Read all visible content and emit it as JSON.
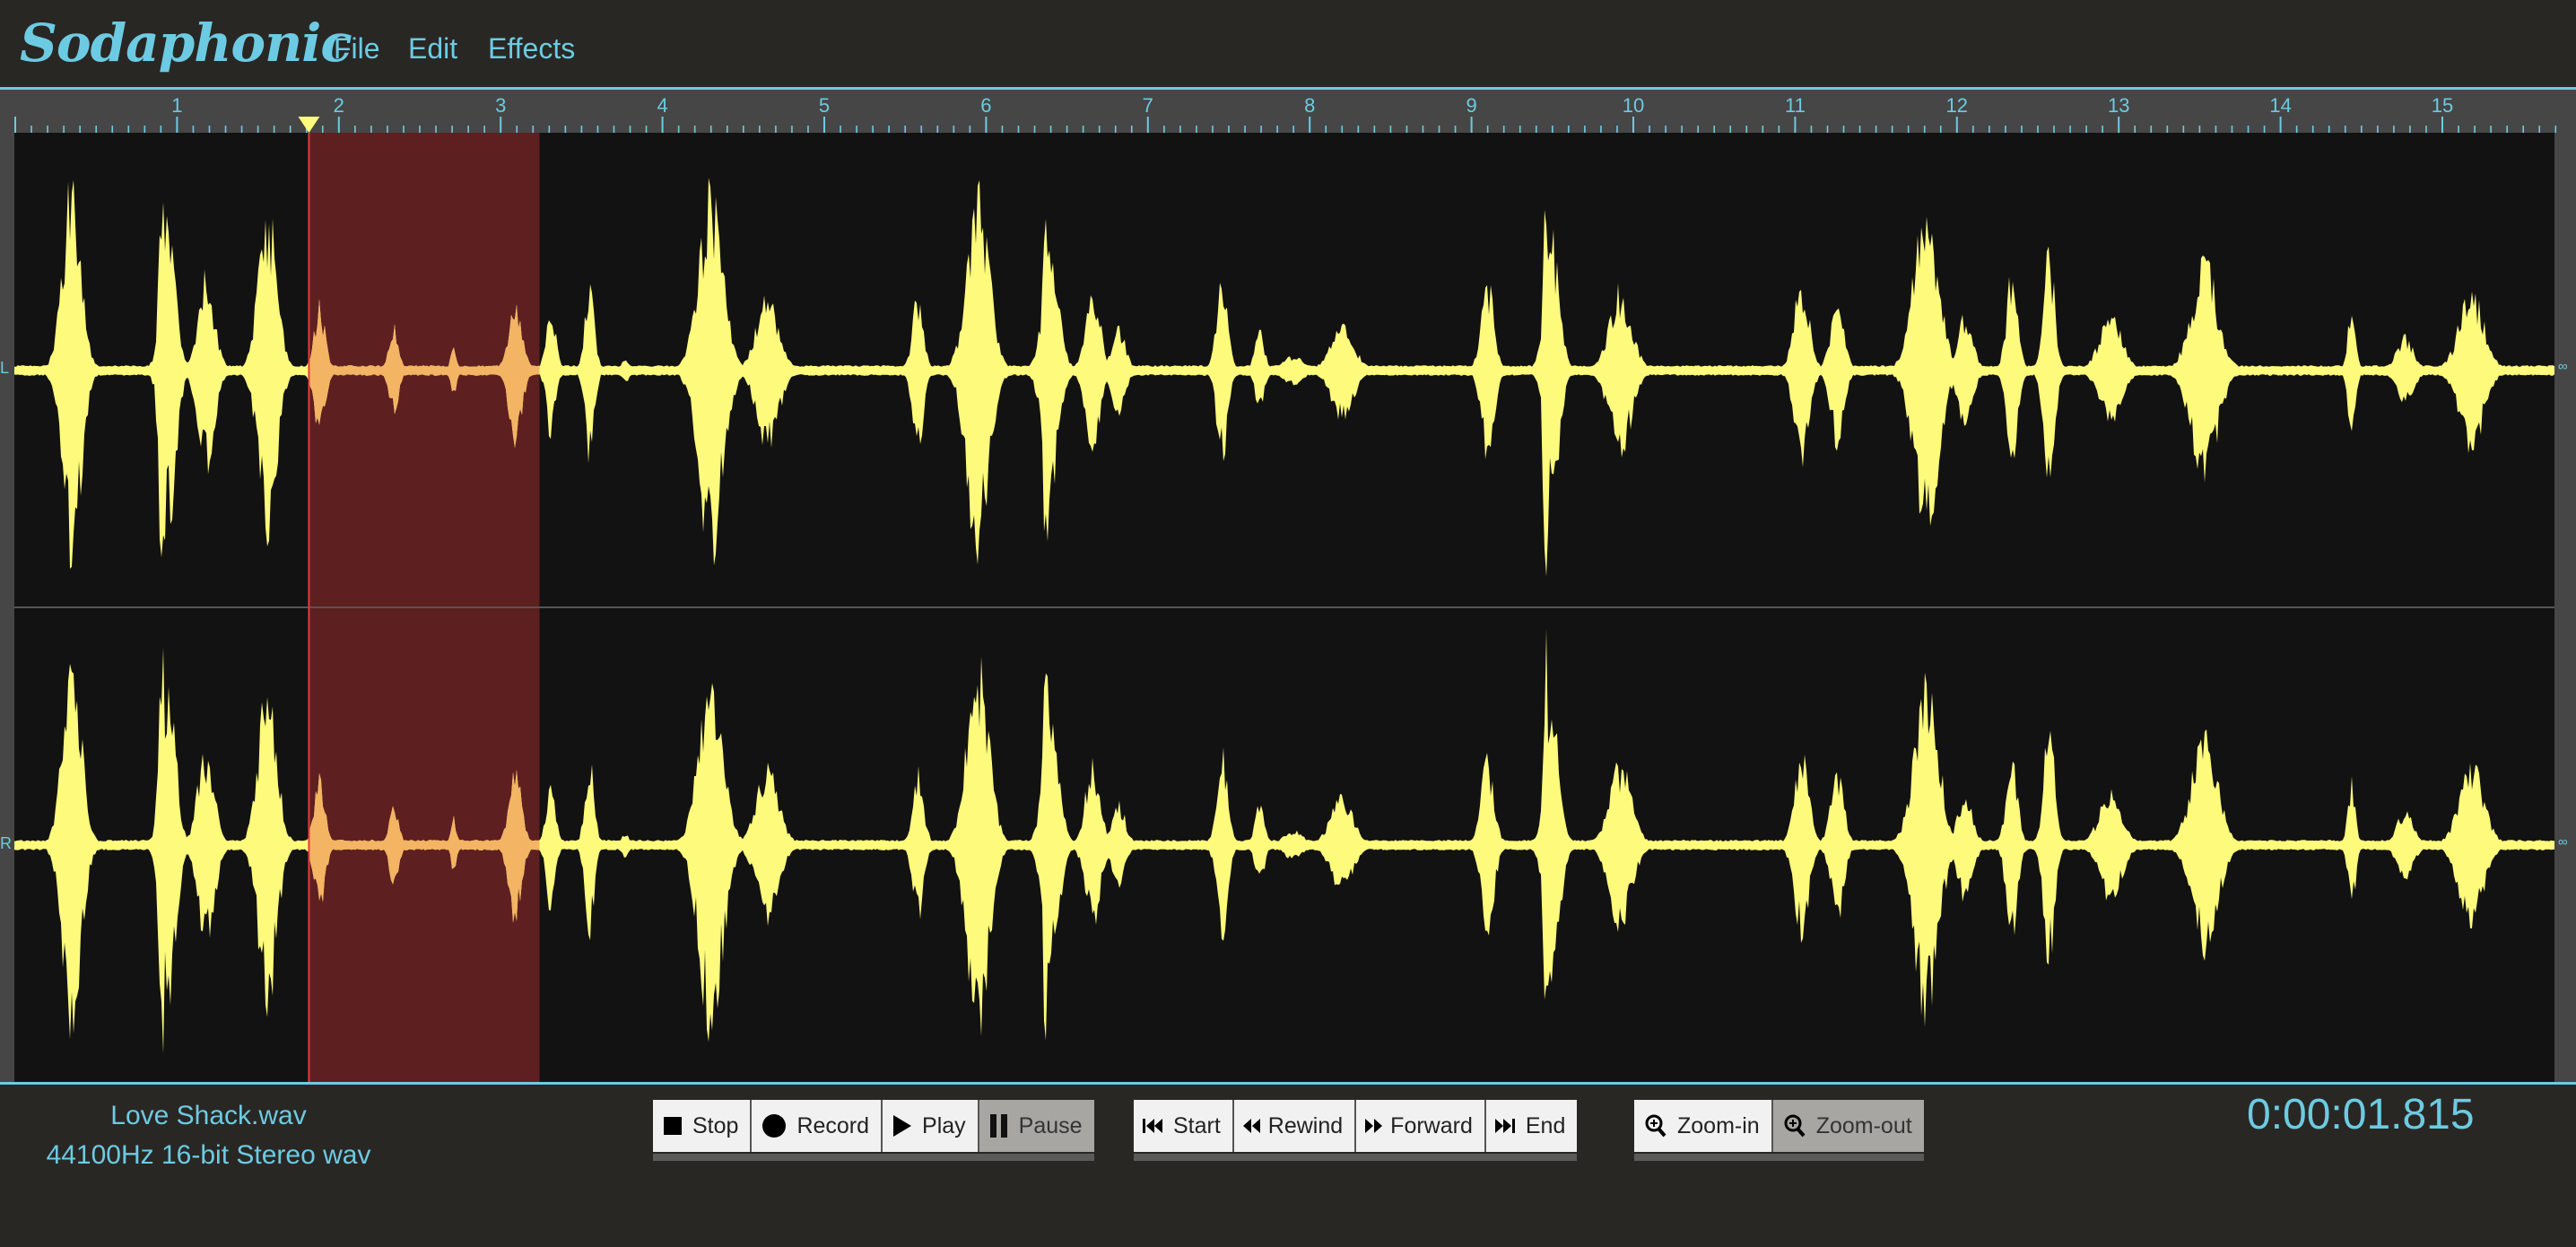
{
  "app": {
    "title": "Sodaphonic"
  },
  "menu": [
    {
      "label": "File"
    },
    {
      "label": "Edit"
    },
    {
      "label": "Effects"
    }
  ],
  "ruler": {
    "labels": [
      "1",
      "2",
      "3",
      "4",
      "5",
      "6",
      "7",
      "8",
      "9",
      "10",
      "11",
      "12",
      "13",
      "14",
      "15"
    ],
    "start_s": 0,
    "end_s": 15.7,
    "minor_step_s": 0.1
  },
  "channels": [
    {
      "label": "L",
      "db_label": "∞"
    },
    {
      "label": "R",
      "db_label": "∞"
    }
  ],
  "selection": {
    "start_s": 1.815,
    "end_s": 3.24
  },
  "playhead_s": 1.815,
  "colors": {
    "accent": "#6ccbe2",
    "waveform": "#fdfa7c",
    "waveform_selected": "#f3b463",
    "selection": "#5e1f21",
    "playhead": "#e53b3b",
    "background": "#121212"
  },
  "waveform_bursts": [
    {
      "t": 0.35,
      "a": 0.9,
      "w": 0.1
    },
    {
      "t": 0.91,
      "a": 1.0,
      "w": 0.04
    },
    {
      "t": 0.95,
      "a": 0.7,
      "w": 0.08
    },
    {
      "t": 1.18,
      "a": 0.45,
      "w": 0.09
    },
    {
      "t": 1.56,
      "a": 0.75,
      "w": 0.1
    },
    {
      "t": 1.88,
      "a": 0.3,
      "w": 0.06
    },
    {
      "t": 2.34,
      "a": 0.2,
      "w": 0.05
    },
    {
      "t": 2.71,
      "a": 0.12,
      "w": 0.03
    },
    {
      "t": 3.09,
      "a": 0.35,
      "w": 0.07
    },
    {
      "t": 3.31,
      "a": 0.3,
      "w": 0.05
    },
    {
      "t": 3.55,
      "a": 0.42,
      "w": 0.05
    },
    {
      "t": 3.77,
      "a": 0.05,
      "w": 0.04
    },
    {
      "t": 4.3,
      "a": 0.85,
      "w": 0.13
    },
    {
      "t": 4.65,
      "a": 0.35,
      "w": 0.12
    },
    {
      "t": 5.58,
      "a": 0.35,
      "w": 0.06
    },
    {
      "t": 5.95,
      "a": 0.85,
      "w": 0.12
    },
    {
      "t": 6.37,
      "a": 1.0,
      "w": 0.03
    },
    {
      "t": 6.4,
      "a": 0.55,
      "w": 0.09
    },
    {
      "t": 6.66,
      "a": 0.38,
      "w": 0.08
    },
    {
      "t": 6.82,
      "a": 0.2,
      "w": 0.07
    },
    {
      "t": 7.46,
      "a": 0.42,
      "w": 0.06
    },
    {
      "t": 7.69,
      "a": 0.18,
      "w": 0.05
    },
    {
      "t": 7.9,
      "a": 0.06,
      "w": 0.1
    },
    {
      "t": 8.2,
      "a": 0.22,
      "w": 0.12
    },
    {
      "t": 9.1,
      "a": 0.4,
      "w": 0.07
    },
    {
      "t": 9.46,
      "a": 1.0,
      "w": 0.03
    },
    {
      "t": 9.5,
      "a": 0.6,
      "w": 0.08
    },
    {
      "t": 9.92,
      "a": 0.38,
      "w": 0.12
    },
    {
      "t": 11.04,
      "a": 0.42,
      "w": 0.08
    },
    {
      "t": 11.26,
      "a": 0.35,
      "w": 0.07
    },
    {
      "t": 11.81,
      "a": 0.8,
      "w": 0.13
    },
    {
      "t": 12.05,
      "a": 0.25,
      "w": 0.08
    },
    {
      "t": 12.34,
      "a": 0.45,
      "w": 0.06
    },
    {
      "t": 12.57,
      "a": 0.55,
      "w": 0.06
    },
    {
      "t": 12.95,
      "a": 0.25,
      "w": 0.12
    },
    {
      "t": 13.53,
      "a": 0.5,
      "w": 0.14
    },
    {
      "t": 14.44,
      "a": 0.3,
      "w": 0.04
    },
    {
      "t": 14.77,
      "a": 0.15,
      "w": 0.09
    },
    {
      "t": 15.18,
      "a": 0.38,
      "w": 0.13
    }
  ],
  "file": {
    "name": "Love Shack.wav",
    "format": "44100Hz 16-bit Stereo wav"
  },
  "transport": [
    {
      "label": "Stop",
      "icon": "stop-icon"
    },
    {
      "label": "Record",
      "icon": "record-icon"
    },
    {
      "label": "Play",
      "icon": "play-icon"
    },
    {
      "label": "Pause",
      "icon": "pause-icon",
      "active": true
    }
  ],
  "navigation": [
    {
      "label": "Start",
      "icon": "skip-start-icon"
    },
    {
      "label": "Rewind",
      "icon": "rewind-icon"
    },
    {
      "label": "Forward",
      "icon": "forward-icon"
    },
    {
      "label": "End",
      "icon": "skip-end-icon"
    }
  ],
  "zoom": [
    {
      "label": "Zoom-in",
      "icon": "zoom-in-icon"
    },
    {
      "label": "Zoom-out",
      "icon": "zoom-out-icon",
      "active": true
    }
  ],
  "timecode": "0:00:01.815"
}
